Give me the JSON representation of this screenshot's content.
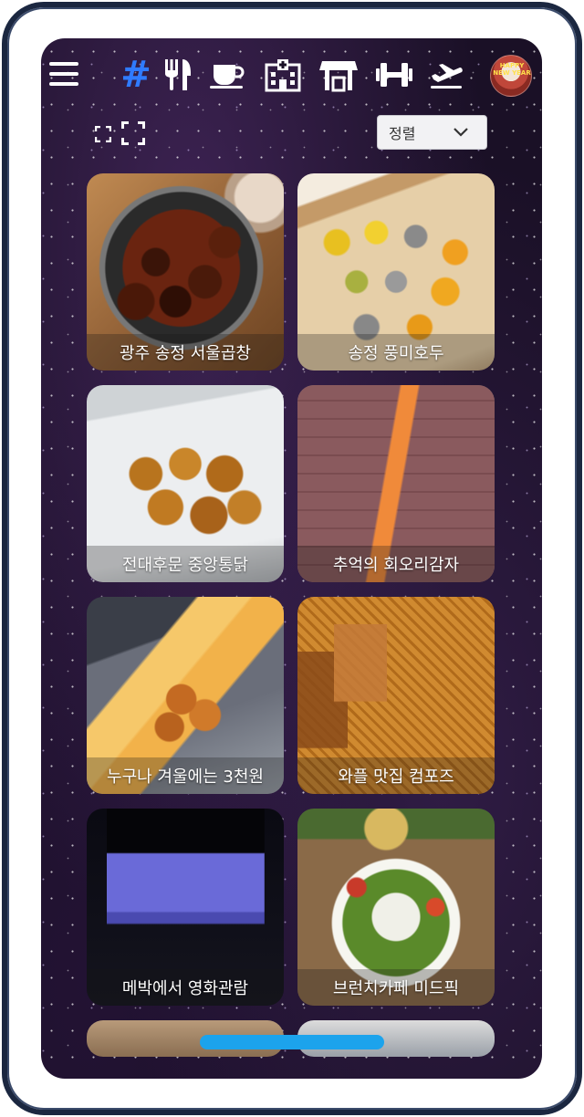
{
  "nav": {
    "items": [
      {
        "icon": "hashtag-icon",
        "glyph": "#",
        "active": true,
        "color": "#2f7bff"
      },
      {
        "icon": "fork-knife-icon"
      },
      {
        "icon": "coffee-cup-icon"
      },
      {
        "icon": "hospital-icon"
      },
      {
        "icon": "store-icon"
      },
      {
        "icon": "dumbbell-icon"
      },
      {
        "icon": "airplane-icon"
      }
    ],
    "avatar_text": "HAPPY NEW YEAR"
  },
  "controls": {
    "sort_label": "정렬"
  },
  "cards": [
    {
      "title": "광주 송정 서울곱창"
    },
    {
      "title": "송정 풍미호두"
    },
    {
      "title": "전대후문 중앙통닭"
    },
    {
      "title": "추억의 회오리감자"
    },
    {
      "title": "누구나 겨울에는 3천원"
    },
    {
      "title": "와플 맛집 컴포즈"
    },
    {
      "title": "메박에서 영화관람"
    },
    {
      "title": "브런치카페 미드픽"
    }
  ],
  "colors": {
    "accent": "#2f7bff",
    "home_indicator": "#1ca3ec",
    "background": "#1a1026"
  }
}
